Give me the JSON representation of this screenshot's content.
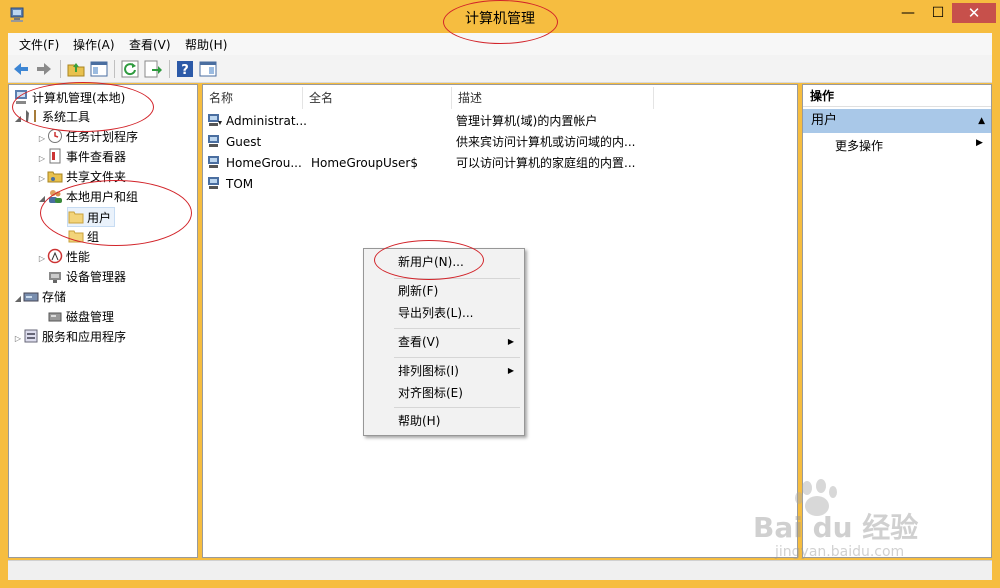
{
  "window": {
    "title": "计算机管理",
    "min_glyph": "—",
    "max_glyph": "☐",
    "close_glyph": "✕"
  },
  "menu": [
    "文件(F)",
    "操作(A)",
    "查看(V)",
    "帮助(H)"
  ],
  "tree": {
    "root": "计算机管理(本地)",
    "system_tools": "系统工具",
    "task_scheduler": "任务计划程序",
    "event_viewer": "事件查看器",
    "shared_folders": "共享文件夹",
    "local_users_groups": "本地用户和组",
    "users": "用户",
    "groups": "组",
    "performance": "性能",
    "device_manager": "设备管理器",
    "storage": "存储",
    "disk_management": "磁盘管理",
    "services_apps": "服务和应用程序"
  },
  "list": {
    "columns": [
      "名称",
      "全名",
      "描述"
    ],
    "rows": [
      {
        "name": "Administrat...",
        "fullname": "",
        "desc": "管理计算机(域)的内置帐户"
      },
      {
        "name": "Guest",
        "fullname": "",
        "desc": "供来宾访问计算机或访问域的内..."
      },
      {
        "name": "HomeGrou...",
        "fullname": "HomeGroupUser$",
        "desc": "可以访问计算机的家庭组的内置..."
      },
      {
        "name": "TOM",
        "fullname": "",
        "desc": ""
      }
    ]
  },
  "context_menu": {
    "new_user": "新用户(N)...",
    "refresh": "刷新(F)",
    "export": "导出列表(L)...",
    "view": "查看(V)",
    "arrange": "排列图标(I)",
    "align": "对齐图标(E)",
    "help": "帮助(H)"
  },
  "actions": {
    "header": "操作",
    "selected": "用户",
    "more": "更多操作"
  },
  "watermark": {
    "brand": "Bai du 经验",
    "url": "jingyan.baidu.com"
  },
  "colors": {
    "frame": "#f6bd40",
    "close": "#c7504b",
    "selection": "#a9c8e8",
    "annotation": "#d2242a"
  }
}
